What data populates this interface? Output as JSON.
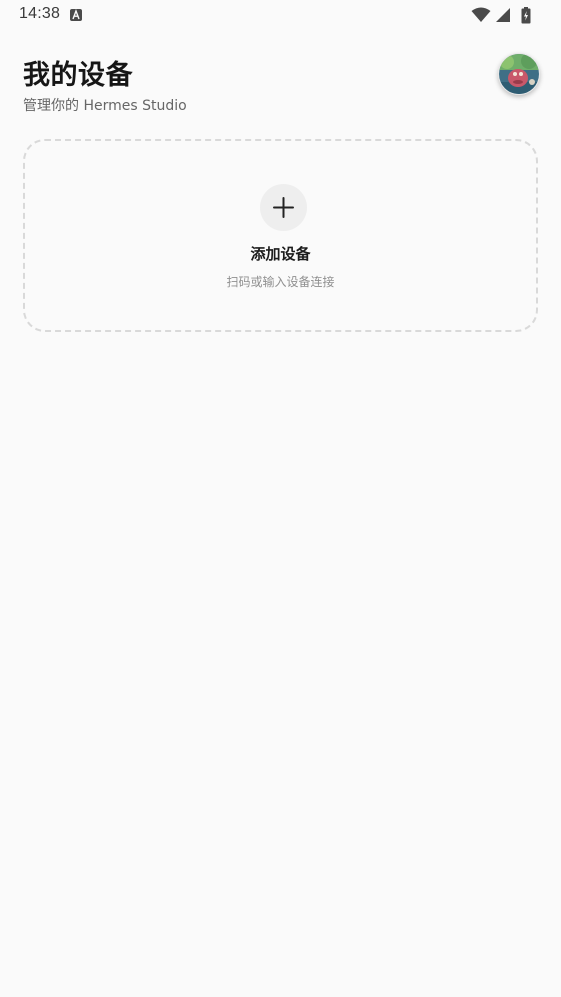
{
  "status_bar": {
    "time": "14:38",
    "icons": [
      "a-notification-icon",
      "wifi-icon",
      "cell-signal-icon",
      "battery-charging-icon"
    ]
  },
  "header": {
    "title": "我的设备",
    "subtitle": "管理你的 Hermes Studio"
  },
  "add_device": {
    "label": "添加设备",
    "hint": "扫码或输入设备连接",
    "icon": "plus-icon"
  },
  "colors": {
    "background": "#fafafa",
    "card_border": "#d9d9d9",
    "plus_bg": "#eeeeee",
    "title_text": "#161616",
    "subtitle_text": "#666666",
    "hint_text": "#8f8f8f"
  }
}
